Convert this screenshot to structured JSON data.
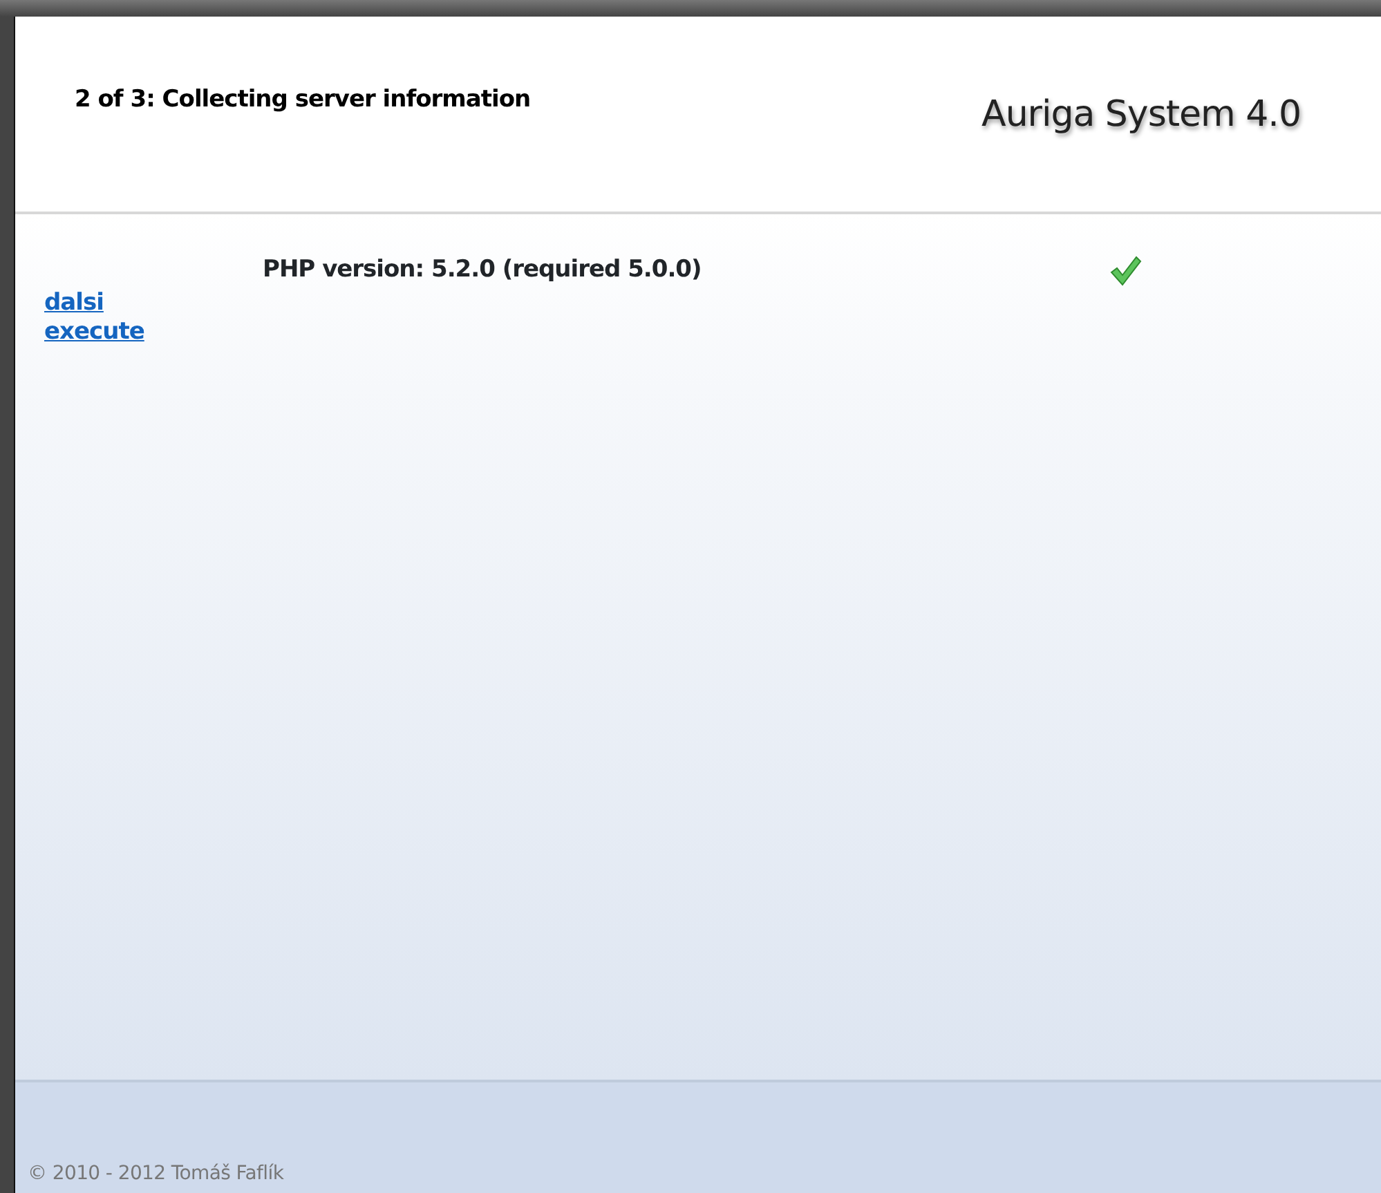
{
  "header": {
    "step": "2 of 3: Collecting server information",
    "product": "Auriga System 4.0"
  },
  "checks": [
    {
      "label": "PHP version: 5.2.0 (required 5.0.0)",
      "passed": true
    }
  ],
  "links": [
    "dalsi",
    "execute"
  ],
  "footer": "© 2010 - 2012 Tomáš Faflík"
}
